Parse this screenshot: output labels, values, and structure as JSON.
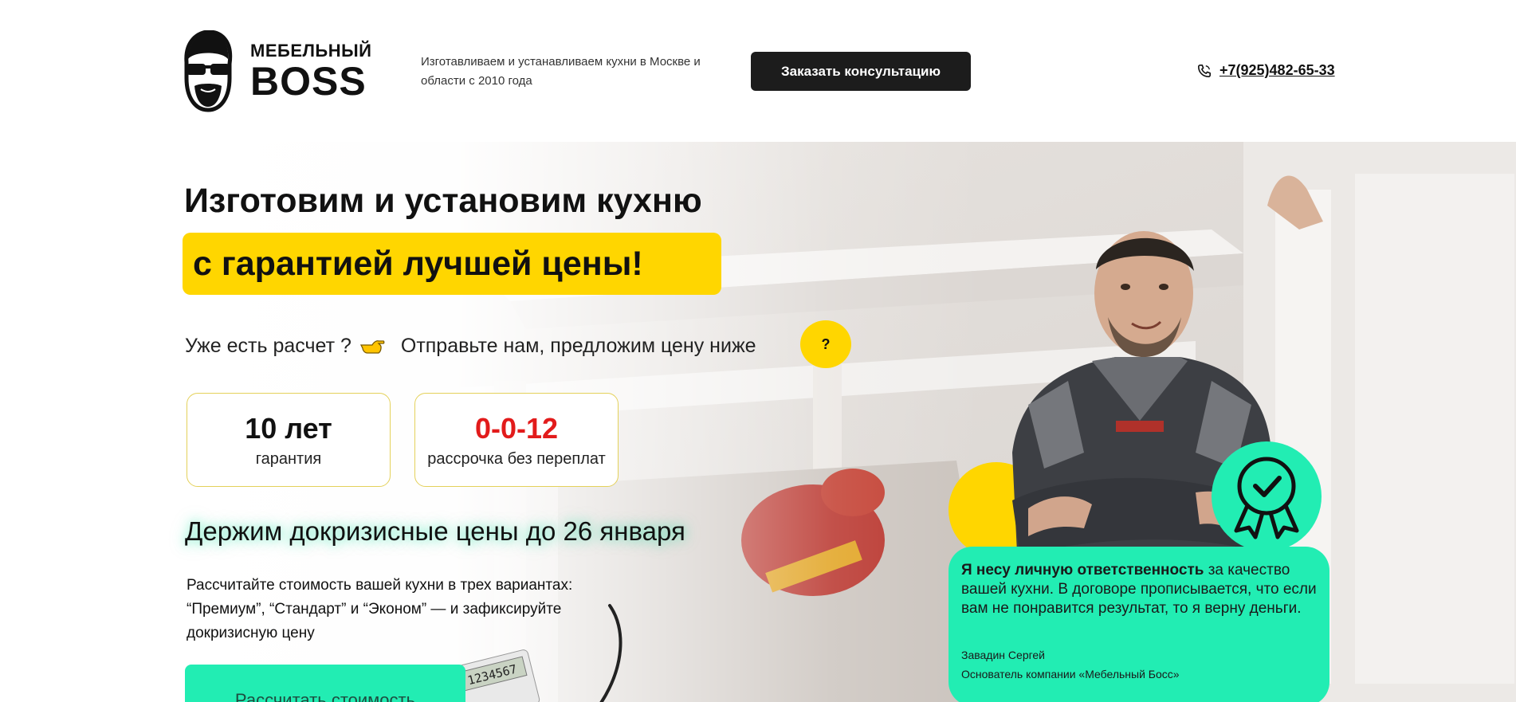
{
  "header": {
    "logo_small": "МЕБЕЛЬНЫЙ",
    "logo_big": "BOSS",
    "tagline": "Изготавливаем и устанавливаем кухни в Москве и области с 2010 года",
    "cta_label": "Заказать консультацию",
    "phone": "+7(925)482-65-33",
    "phone_icon": "phone-icon"
  },
  "hero": {
    "title": "Изготовим и установим кухню",
    "title_highlight": "с гарантией лучшей цены!",
    "calc_question": "Уже есть расчет ?",
    "calc_offer": "Отправьте нам, предложим цену ниже",
    "help_label": "?",
    "cards": [
      {
        "value": "10 лет",
        "label": "гарантия"
      },
      {
        "value": "0-0-12",
        "label": "рассрочка без переплат"
      }
    ],
    "crisis_heading": "Держим докризисные цены до 26 января",
    "calc_description": "Рассчитайте стоимость вашей кухни в трех вариантах: “Премиум”, “Стандарт” и “Эконом” — и зафиксируйте докризисную цену",
    "calc_button": "Рассчитать стоимость",
    "calculator_display": "1234567",
    "quote": {
      "bold": "Я несу личную ответственность",
      "text": " за качество вашей кухни. В договоре прописывается, что если вам не понравится результат, то я верну деньги.",
      "name": "Завадин Сергей",
      "role": "Основатель компании «Мебельный Босс»"
    }
  },
  "colors": {
    "accent_yellow": "#ffd600",
    "accent_green": "#22edb3",
    "dark_button": "#1c1c1c",
    "highlight_red": "#e21b1b"
  }
}
